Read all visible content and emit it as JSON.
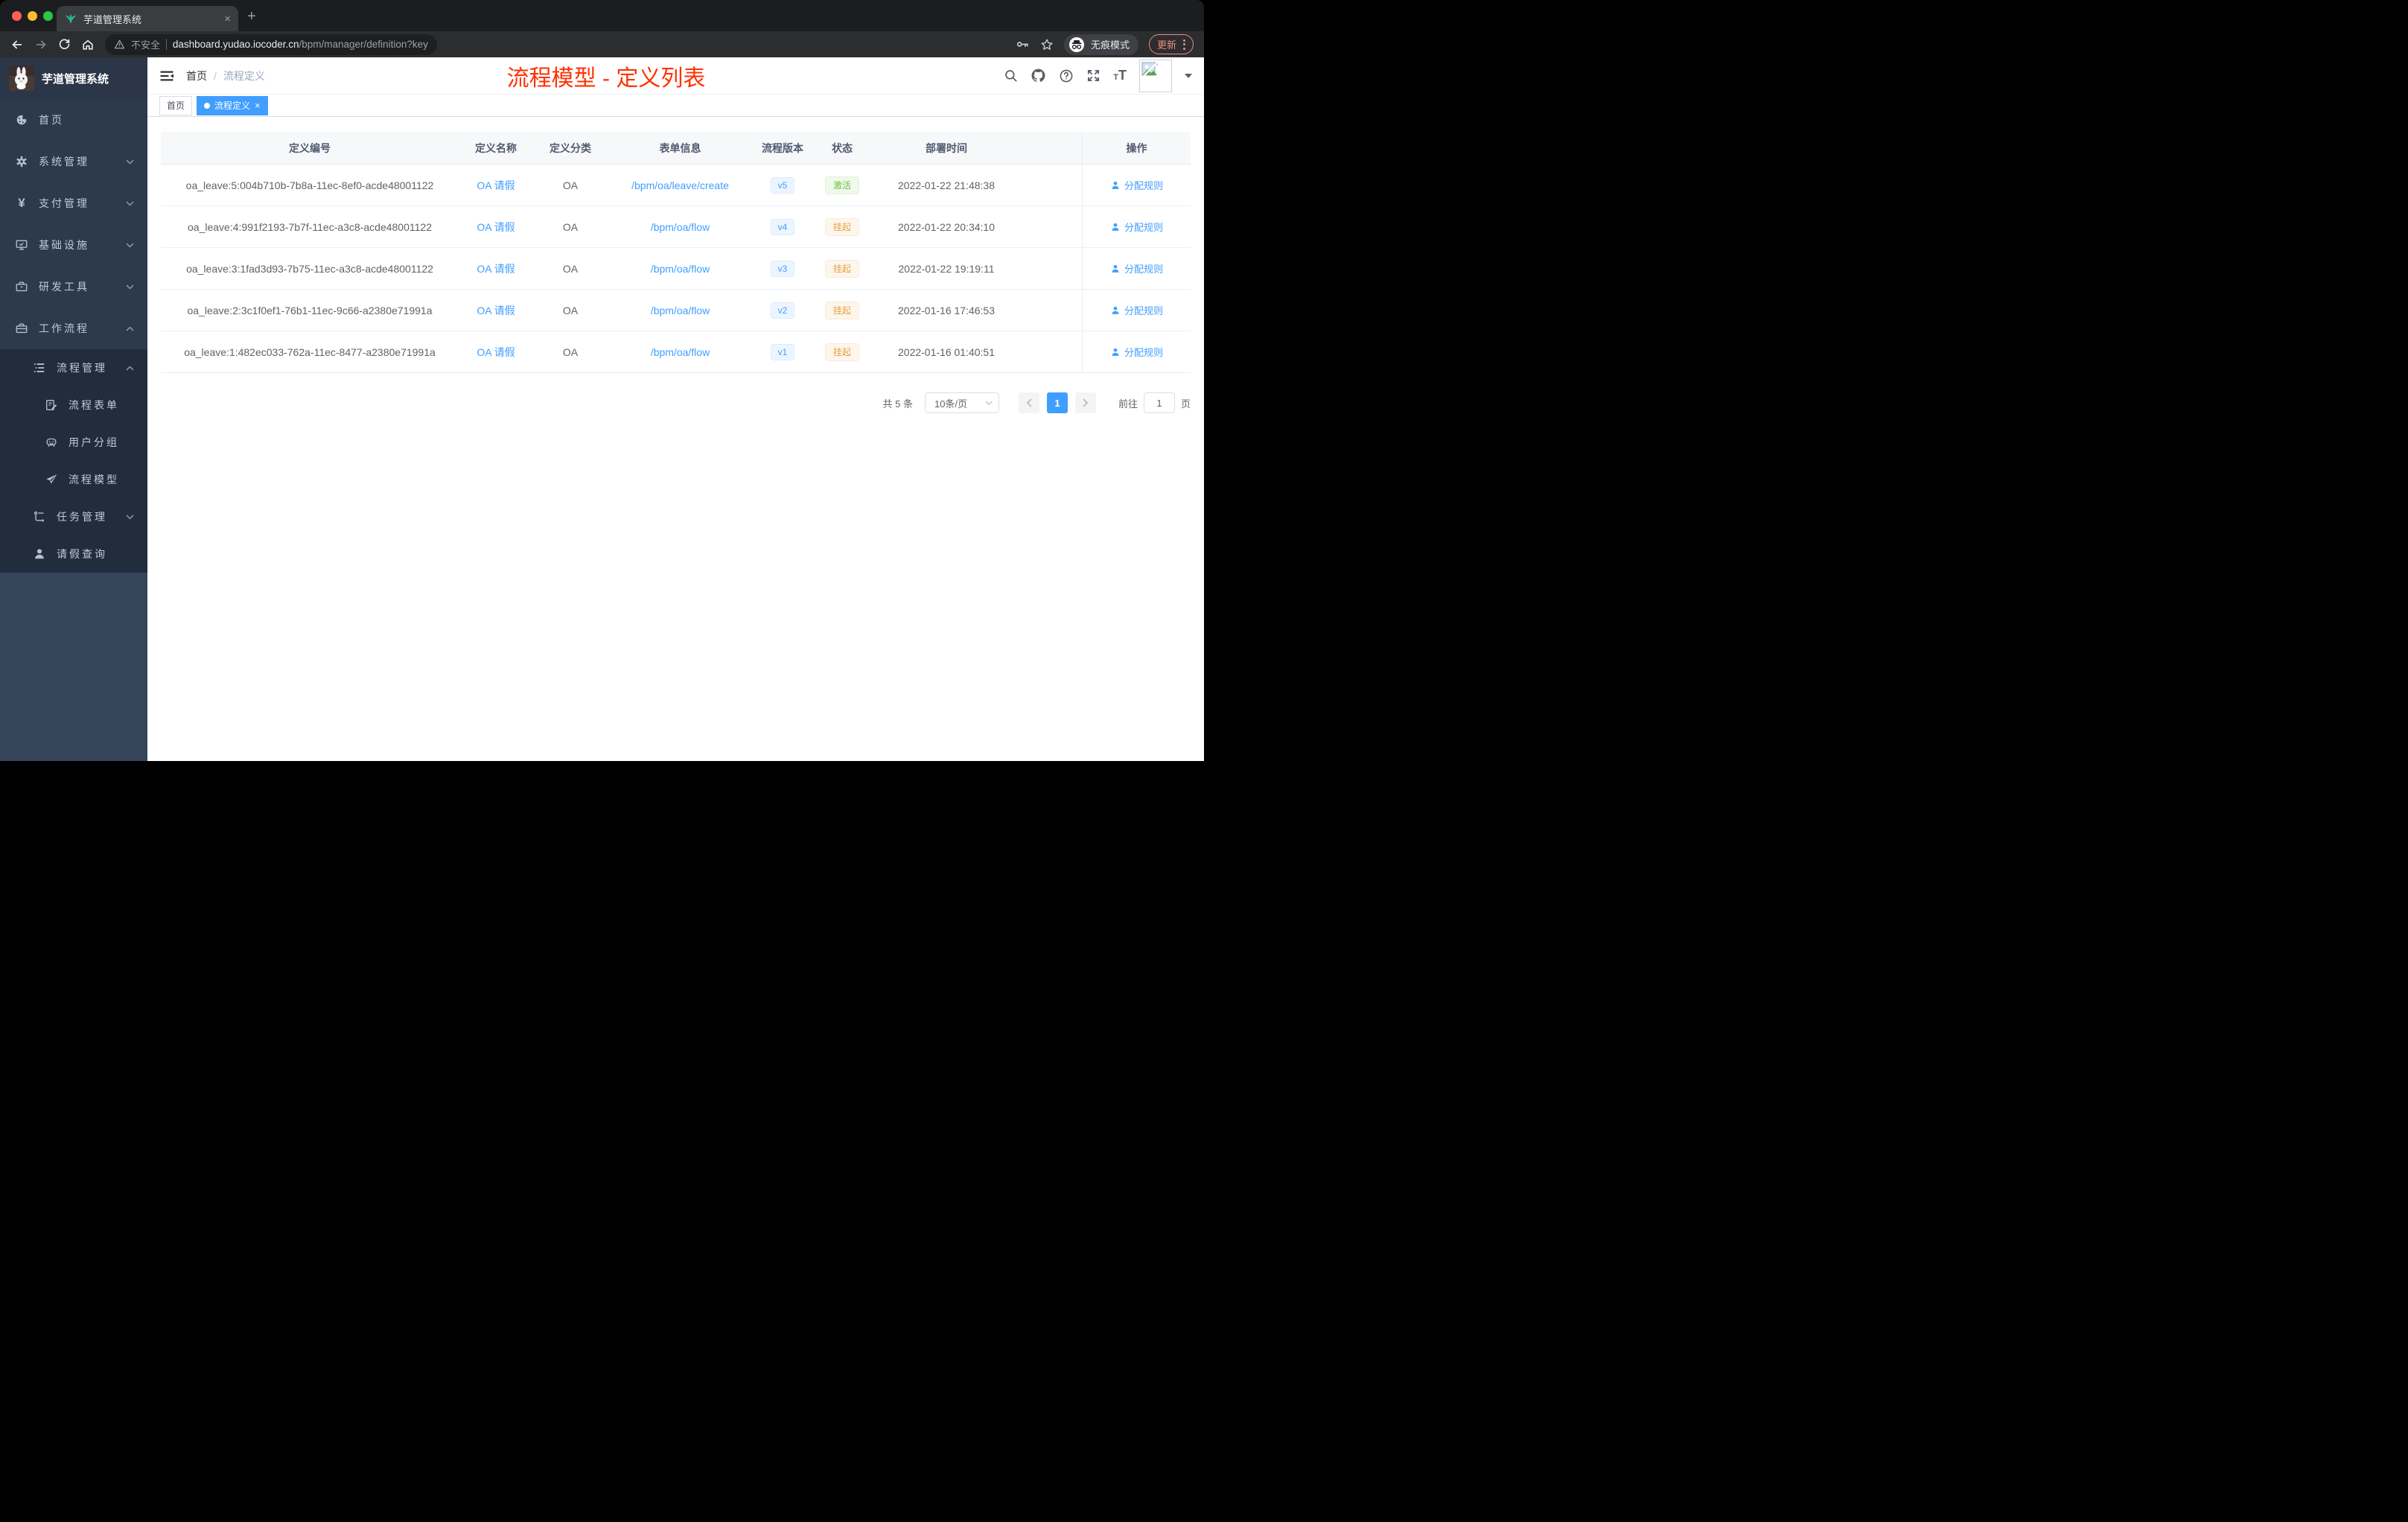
{
  "colors": {
    "accent": "#409eff",
    "title_red": "#ff3100",
    "success": "#67c23a",
    "warning": "#e6a23c",
    "sidebar_bg": "#2d3a4d",
    "submenu_bg": "#212d3c"
  },
  "browser": {
    "tab_title": "芋道管理系统",
    "close_glyph": "×",
    "newtab_glyph": "+",
    "security_label": "不安全",
    "url_host": "dashboard.yudao.iocoder.cn",
    "url_path": "/bpm/manager/definition?key=oa_leave",
    "incognito_label": "无痕模式",
    "update_label": "更新"
  },
  "sidebar": {
    "logo_title": "芋道管理系统",
    "items": [
      {
        "label": "首页",
        "icon": "dashboard-icon"
      },
      {
        "label": "系统管理",
        "icon": "gear-icon",
        "chevron": "down"
      },
      {
        "label": "支付管理",
        "icon": "yen-icon",
        "chevron": "down"
      },
      {
        "label": "基础设施",
        "icon": "monitor-icon",
        "chevron": "down"
      },
      {
        "label": "研发工具",
        "icon": "toolbox-icon",
        "chevron": "down"
      },
      {
        "label": "工作流程",
        "icon": "briefcase-icon",
        "chevron": "up"
      }
    ],
    "workflow_children": [
      {
        "label": "流程管理",
        "icon": "tree-list-icon",
        "chevron": "up"
      },
      {
        "label": "流程表单",
        "icon": "form-edit-icon"
      },
      {
        "label": "用户分组",
        "icon": "robot-icon"
      },
      {
        "label": "流程模型",
        "icon": "paper-plane-icon"
      },
      {
        "label": "任务管理",
        "icon": "flow-icon",
        "chevron": "down"
      },
      {
        "label": "请假查询",
        "icon": "user-icon"
      }
    ]
  },
  "header": {
    "breadcrumb_home": "首页",
    "breadcrumb_sep": "/",
    "breadcrumb_current": "流程定义",
    "page_title": "流程模型 - 定义列表"
  },
  "tags": {
    "home": "首页",
    "active": "流程定义",
    "close_glyph": "×"
  },
  "table": {
    "columns": [
      "定义编号",
      "定义名称",
      "定义分类",
      "表单信息",
      "流程版本",
      "状态",
      "部署时间",
      "操作"
    ],
    "action_label": "分配规则",
    "rows": [
      {
        "id": "oa_leave:5:004b710b-7b8a-11ec-8ef0-acde48001122",
        "name": "OA 请假",
        "category": "OA",
        "form": "/bpm/oa/leave/create",
        "version": "v5",
        "status": "激活",
        "time": "2022-01-22 21:48:38"
      },
      {
        "id": "oa_leave:4:991f2193-7b7f-11ec-a3c8-acde48001122",
        "name": "OA 请假",
        "category": "OA",
        "form": "/bpm/oa/flow",
        "version": "v4",
        "status": "挂起",
        "time": "2022-01-22 20:34:10"
      },
      {
        "id": "oa_leave:3:1fad3d93-7b75-11ec-a3c8-acde48001122",
        "name": "OA 请假",
        "category": "OA",
        "form": "/bpm/oa/flow",
        "version": "v3",
        "status": "挂起",
        "time": "2022-01-22 19:19:11"
      },
      {
        "id": "oa_leave:2:3c1f0ef1-76b1-11ec-9c66-a2380e71991a",
        "name": "OA 请假",
        "category": "OA",
        "form": "/bpm/oa/flow",
        "version": "v2",
        "status": "挂起",
        "time": "2022-01-16 17:46:53"
      },
      {
        "id": "oa_leave:1:482ec033-762a-11ec-8477-a2380e71991a",
        "name": "OA 请假",
        "category": "OA",
        "form": "/bpm/oa/flow",
        "version": "v1",
        "status": "挂起",
        "time": "2022-01-16 01:40:51"
      }
    ]
  },
  "pagination": {
    "total": "共 5 条",
    "page_size": "10条/页",
    "current_page": "1",
    "prev_glyph": "‹",
    "next_glyph": "›",
    "goto_label": "前往",
    "goto_value": "1",
    "page_unit": "页"
  }
}
